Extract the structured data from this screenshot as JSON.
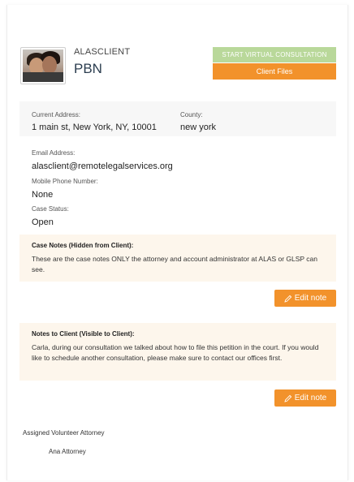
{
  "client": {
    "name": "ALASCLIENT",
    "org": "PBN"
  },
  "actions": {
    "virtual_consultation": "START VIRTUAL CONSULTATION",
    "client_files": "Client Files"
  },
  "details": {
    "current_address_label": "Current Address:",
    "current_address": "1 main st, New York, NY, 10001",
    "county_label": "County:",
    "county": "new york",
    "email_label": "Email Address:",
    "email": "alasclient@remotelegalservices.org",
    "mobile_label": "Mobile Phone Number:",
    "mobile": "None",
    "case_status_label": "Case Status:",
    "case_status": "Open"
  },
  "case_notes": {
    "title": "Case Notes (Hidden from Client):",
    "text": "These are the case notes ONLY the attorney and account administrator at ALAS or GLSP can see.",
    "edit_label": "Edit note"
  },
  "client_notes": {
    "title": "Notes to Client (Visible to Client):",
    "text": "Carla, during our consultation we talked about how to file this petition in the court.  If you would like to schedule another consultation, please make sure to contact our offices first.",
    "edit_label": "Edit note"
  },
  "attorney": {
    "label": "Assigned Volunteer Attorney",
    "name": "Ana Attorney"
  },
  "colors": {
    "accent_orange": "#f2922b",
    "accent_green": "#b9d89a",
    "notes_bg": "#fdf6ec",
    "info_bg": "#f7f7f7"
  }
}
